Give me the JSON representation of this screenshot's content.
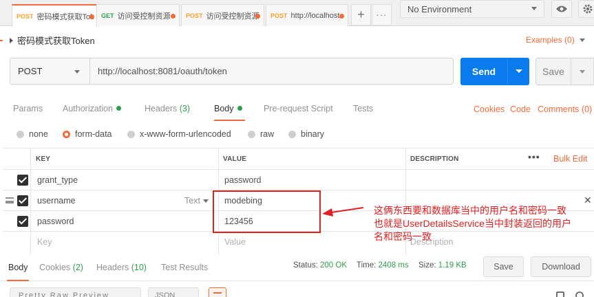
{
  "tabs": [
    {
      "method": "POST",
      "title": "密码模式获取Token",
      "active": true
    },
    {
      "method": "GET",
      "title": "访问受控制资源",
      "active": false
    },
    {
      "method": "POST",
      "title": "访问受控制资源",
      "active": false
    },
    {
      "method": "POST",
      "title": "http://localhost",
      "active": false
    }
  ],
  "tab_actions": {
    "add": "+",
    "more": "···"
  },
  "environment": {
    "selected": "No Environment"
  },
  "request": {
    "name": "密码模式获取Token",
    "examples_label": "Examples (0)",
    "method": "POST",
    "url": "http://localhost:8081/oauth/token",
    "send_label": "Send",
    "save_label": "Save"
  },
  "request_tabs": {
    "params": "Params",
    "authorization": "Authorization",
    "headers": "Headers",
    "headers_count": "(3)",
    "body": "Body",
    "pre_request": "Pre-request Script",
    "tests": "Tests",
    "cookies_link": "Cookies",
    "code_link": "Code",
    "comments_link": "Comments (0)"
  },
  "body_types": [
    "none",
    "form-data",
    "x-www-form-urlencoded",
    "raw",
    "binary"
  ],
  "body_type_selected": "form-data",
  "table": {
    "headers": {
      "key": "KEY",
      "value": "VALUE",
      "description": "DESCRIPTION",
      "more": "•••",
      "bulk_edit": "Bulk Edit"
    },
    "rows": [
      {
        "key": "grant_type",
        "value": "password",
        "checked": true
      },
      {
        "key": "username",
        "value": "modebing",
        "checked": true,
        "type": "Text"
      },
      {
        "key": "password",
        "value": "123456",
        "checked": true
      }
    ],
    "placeholders": {
      "key": "Key",
      "value": "Value",
      "description": "Description"
    }
  },
  "annotation": {
    "lines": [
      "这俩东西要和数据库当中的用户名和密码一致",
      "也就是UserDetailsService当中封装返回的用户",
      "名和密码一致"
    ]
  },
  "response": {
    "tabs": {
      "body": "Body",
      "cookies": "Cookies",
      "cookies_count": "(2)",
      "headers": "Headers",
      "headers_count": "(10)",
      "test_results": "Test Results"
    },
    "status_label": "Status:",
    "status_value": "200 OK",
    "time_label": "Time:",
    "time_value": "2408 ms",
    "size_label": "Size:",
    "size_value": "1.19 KB",
    "save_label": "Save",
    "download_label": "Download",
    "view_modes": "Pretty  Raw  Preview",
    "format": "JSON"
  },
  "colors": {
    "accent": "#f26b3a",
    "send_blue": "#097bed",
    "success_green": "#2d9e4c",
    "annotation_red": "#e02020",
    "method_post": "#f6a22a",
    "method_get": "#2d9e4c"
  }
}
